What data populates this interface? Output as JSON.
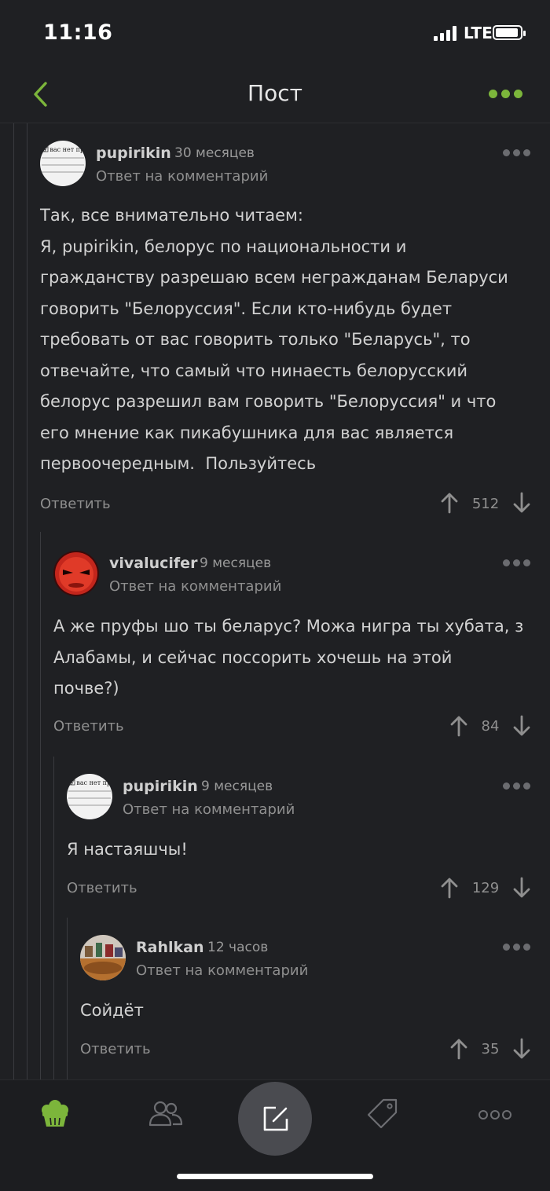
{
  "status_bar": {
    "time": "11:16",
    "network": "LTE"
  },
  "nav": {
    "title": "Пост",
    "back_icon": "chevron-left-icon",
    "more_icon": "more-dots-icon",
    "accent": "#7cb53b"
  },
  "comments": [
    {
      "author": "pupirikin",
      "age": "30 месяцев",
      "subline": "Ответ на комментарий",
      "avatar_text": "У вас нет прав для просмотра этого аватара",
      "body": "Так, все внимательно читаем:\nЯ, pupirikin, белорус по национальности и\nгражданству разрешаю всем негражданам Беларуси\nговорить \"Белоруссия\". Если кто-нибудь будет\nтребовать от вас говорить только \"Беларусь\", то\nотвечайте, что самый что нинаесть белорусский\nбелорус разрешил вам говорить \"Белоруссия\" и что\nего мнение как пикабушника для вас является\nпервоочередным.  Пользуйтесь",
      "reply": "Ответить",
      "score": "512"
    },
    {
      "author": "vivalucifer",
      "age": "9 месяцев",
      "subline": "Ответ на комментарий",
      "body": "А же пруфы шо ты беларус? Можа нигра ты хубата, з\nАлабамы, и сейчас поссорить хочешь на этой\nпочве?)",
      "reply": "Ответить",
      "score": "84"
    },
    {
      "author": "pupirikin",
      "age": "9 месяцев",
      "subline": "Ответ на комментарий",
      "avatar_text": "У вас нет прав для просмотра этого аватара",
      "body": "Я настаяшчы!",
      "reply": "Ответить",
      "score": "129"
    },
    {
      "author": "Rahlkan",
      "age": "12 часов",
      "subline": "Ответ на комментарий",
      "body": "Сойдёт",
      "reply": "Ответить",
      "score": "35"
    }
  ],
  "tabbar": {
    "items": [
      "home-icon",
      "community-icon",
      "compose-icon",
      "tag-icon",
      "more-icon"
    ],
    "active_color": "#7cb53b",
    "inactive_color": "#6d6e72"
  }
}
